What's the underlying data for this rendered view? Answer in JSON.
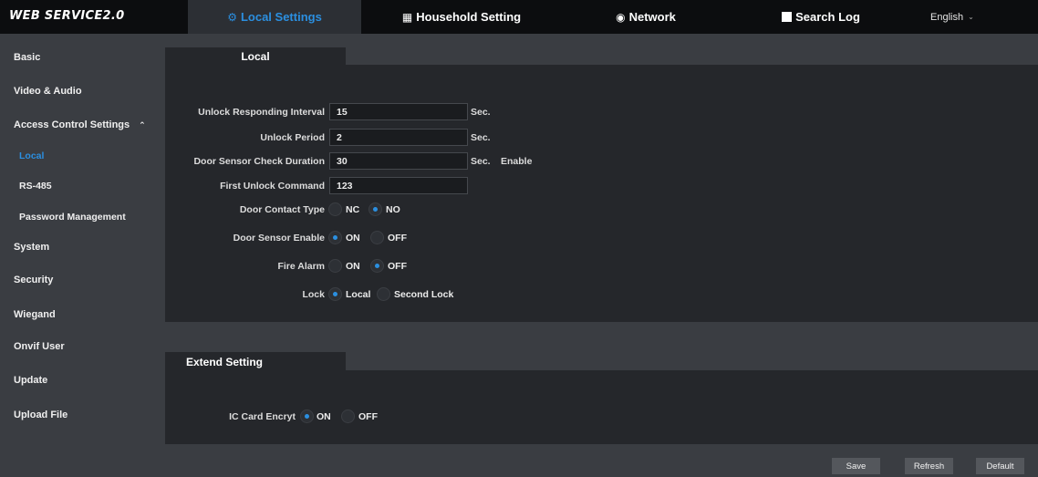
{
  "brand": "WEB SERVICE2.0",
  "nav": [
    {
      "label": "Local Settings",
      "icon": "gear-icon",
      "active": true
    },
    {
      "label": "Household Setting",
      "icon": "building-icon",
      "active": false
    },
    {
      "label": "Network",
      "icon": "globe-icon",
      "active": false
    },
    {
      "label": "Search Log",
      "icon": "log-icon",
      "active": false
    }
  ],
  "language": "English",
  "sidebar": {
    "items": [
      {
        "label": "Basic"
      },
      {
        "label": "Video & Audio"
      },
      {
        "label": "Access Control Settings"
      },
      {
        "label": "Local"
      },
      {
        "label": "RS-485"
      },
      {
        "label": "Password Management"
      },
      {
        "label": "System"
      },
      {
        "label": "Security"
      },
      {
        "label": "Wiegand"
      },
      {
        "label": "Onvif User"
      },
      {
        "label": "Update"
      },
      {
        "label": "Upload File"
      }
    ]
  },
  "local": {
    "tab": "Local",
    "unlock_interval": {
      "label": "Unlock Responding Interval",
      "value": "15",
      "unit": "Sec."
    },
    "unlock_period": {
      "label": "Unlock Period",
      "value": "2",
      "unit": "Sec."
    },
    "door_sensor_duration": {
      "label": "Door Sensor Check Duration",
      "value": "30",
      "unit": "Sec.",
      "enable": "Enable"
    },
    "first_unlock": {
      "label": "First Unlock Command",
      "value": "123"
    },
    "door_contact": {
      "label": "Door Contact Type",
      "opt1": "NC",
      "opt2": "NO",
      "selected": "NO"
    },
    "door_sensor_enable": {
      "label": "Door Sensor Enable",
      "opt1": "ON",
      "opt2": "OFF",
      "selected": "ON"
    },
    "fire_alarm": {
      "label": "Fire Alarm",
      "opt1": "ON",
      "opt2": "OFF",
      "selected": "OFF"
    },
    "lock": {
      "label": "Lock",
      "opt1": "Local",
      "opt2": "Second Lock",
      "selected": "Local"
    }
  },
  "extend": {
    "tab": "Extend Setting",
    "ic_card": {
      "label": "IC Card Encryt",
      "opt1": "ON",
      "opt2": "OFF",
      "selected": "ON"
    }
  },
  "buttons": {
    "save": "Save",
    "refresh": "Refresh",
    "default": "Default"
  },
  "colors": {
    "accent": "#2b8fe0",
    "topbar": "#0c0d0f",
    "panel": "#25272b",
    "background": "#3a3d42"
  }
}
